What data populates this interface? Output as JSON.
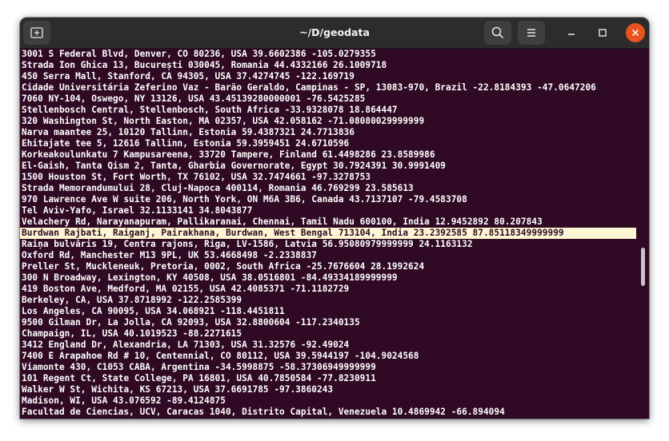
{
  "window": {
    "title": "~/D/geodata"
  },
  "terminal": {
    "lines": [
      {
        "text": "3001 S Federal Blvd, Denver, CO 80236, USA 39.6602386 -105.0279355",
        "highlighted": false
      },
      {
        "text": "Strada Ion Ghica 13, București 030045, Romania 44.4332166 26.1009718",
        "highlighted": false
      },
      {
        "text": "450 Serra Mall, Stanford, CA 94305, USA 37.4274745 -122.169719",
        "highlighted": false
      },
      {
        "text": "Cidade Universitária Zeferino Vaz - Barão Geraldo, Campinas - SP, 13083-970, Brazil -22.8184393 -47.0647206",
        "highlighted": false
      },
      {
        "text": "7060 NY-104, Oswego, NY 13126, USA 43.45139280000001 -76.5425285",
        "highlighted": false
      },
      {
        "text": "Stellenbosch Central, Stellenbosch, South Africa -33.9328078 18.864447",
        "highlighted": false
      },
      {
        "text": "320 Washington St, North Easton, MA 02357, USA 42.058162 -71.08080029999999",
        "highlighted": false
      },
      {
        "text": "Narva maantee 25, 10120 Tallinn, Estonia 59.4387321 24.7713836",
        "highlighted": false
      },
      {
        "text": "Ehitajate tee 5, 12616 Tallinn, Estonia 59.3959451 24.6710596",
        "highlighted": false
      },
      {
        "text": "Korkeakoulunkatu 7 Kampusareena, 33720 Tampere, Finland 61.4498286 23.8589986",
        "highlighted": false
      },
      {
        "text": "El-Gaish, Tanta Qism 2, Tanta, Gharbia Governorate, Egypt 30.7924391 30.9991409",
        "highlighted": false
      },
      {
        "text": "1500 Houston St, Fort Worth, TX 76102, USA 32.7474661 -97.3278753",
        "highlighted": false
      },
      {
        "text": "Strada Memorandumului 28, Cluj-Napoca 400114, Romania 46.769299 23.585613",
        "highlighted": false
      },
      {
        "text": "970 Lawrence Ave W suite 206, North York, ON M6A 3B6, Canada 43.7137107 -79.4583708",
        "highlighted": false
      },
      {
        "text": "Tel Aviv-Yafo, Israel 32.1133141 34.8043877",
        "highlighted": false
      },
      {
        "text": "Velachery Rd, Narayanapuram, Pallikaranai, Chennai, Tamil Nadu 600100, India 12.9452892 80.207843",
        "highlighted": false
      },
      {
        "text": "Burdwan Rajbati, Raiganj, Pairakhana, Burdwan, West Bengal 713104, India 23.2392585 87.85118349999999",
        "highlighted": true
      },
      {
        "text": "Raiņa bulvāris 19, Centra rajons, Riga, LV-1586, Latvia 56.95080979999999 24.1163132",
        "highlighted": false
      },
      {
        "text": "Oxford Rd, Manchester M13 9PL, UK 53.4668498 -2.2338837",
        "highlighted": false
      },
      {
        "text": "Preller St, Muckleneuk, Pretoria, 0002, South Africa -25.7676604 28.1992624",
        "highlighted": false
      },
      {
        "text": "300 N Broadway, Lexington, KY 40508, USA 38.0516801 -84.49334189999999",
        "highlighted": false
      },
      {
        "text": "419 Boston Ave, Medford, MA 02155, USA 42.4085371 -71.1182729",
        "highlighted": false
      },
      {
        "text": "Berkeley, CA, USA 37.8718992 -122.2585399",
        "highlighted": false
      },
      {
        "text": "Los Angeles, CA 90095, USA 34.068921 -118.4451811",
        "highlighted": false
      },
      {
        "text": "9500 Gilman Dr, La Jolla, CA 92093, USA 32.8800604 -117.2340135",
        "highlighted": false
      },
      {
        "text": "Champaign, IL, USA 40.1019523 -88.2271615",
        "highlighted": false
      },
      {
        "text": "3412 England Dr, Alexandria, LA 71303, USA 31.32576 -92.49024",
        "highlighted": false
      },
      {
        "text": "7400 E Arapahoe Rd # 10, Centennial, CO 80112, USA 39.5944197 -104.9024568",
        "highlighted": false
      },
      {
        "text": "Viamonte 430, C1053 CABA, Argentina -34.5998875 -58.37306949999999",
        "highlighted": false
      },
      {
        "text": "101 Regent Ct, State College, PA 16801, USA 40.7850584 -77.8230911",
        "highlighted": false
      },
      {
        "text": "Walker W St, Wichita, KS 67213, USA 37.6691785 -97.3860243",
        "highlighted": false
      },
      {
        "text": "Madison, WI, USA 43.076592 -89.4124875",
        "highlighted": false
      },
      {
        "text": "Facultad de Ciencias, UCV, Caracas 1040, Distrito Capital, Venezuela 10.4869942 -66.894094",
        "highlighted": false
      }
    ]
  },
  "icons": {
    "new_tab": "new-tab-icon",
    "search": "search-icon",
    "menu": "hamburger-menu-icon",
    "minimize": "minimize-icon",
    "maximize": "maximize-icon",
    "close": "close-icon"
  },
  "colors": {
    "terminal_background": "#300a24",
    "terminal_text": "#ffffff",
    "highlight_background": "#fcf7d2",
    "titlebar": "#2c2c2c",
    "close_button": "#e95420"
  }
}
